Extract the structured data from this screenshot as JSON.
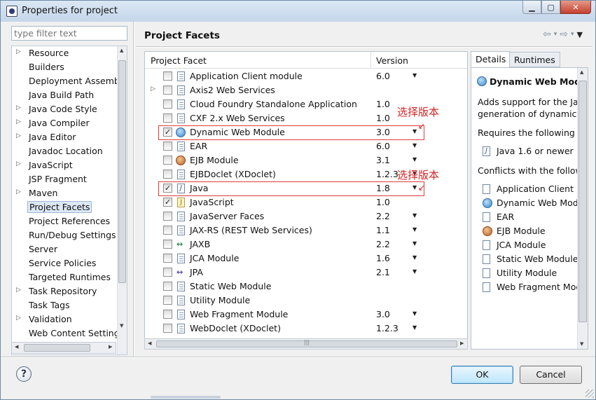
{
  "window": {
    "title": "Properties for project"
  },
  "filter": {
    "placeholder": "type filter text"
  },
  "tree": {
    "items": [
      {
        "label": "Resource",
        "expandable": true,
        "selected": false
      },
      {
        "label": "Builders",
        "expandable": false,
        "selected": false
      },
      {
        "label": "Deployment Assembly",
        "expandable": false,
        "selected": false
      },
      {
        "label": "Java Build Path",
        "expandable": false,
        "selected": false
      },
      {
        "label": "Java Code Style",
        "expandable": true,
        "selected": false
      },
      {
        "label": "Java Compiler",
        "expandable": true,
        "selected": false
      },
      {
        "label": "Java Editor",
        "expandable": true,
        "selected": false
      },
      {
        "label": "Javadoc Location",
        "expandable": false,
        "selected": false
      },
      {
        "label": "JavaScript",
        "expandable": true,
        "selected": false
      },
      {
        "label": "JSP Fragment",
        "expandable": false,
        "selected": false
      },
      {
        "label": "Maven",
        "expandable": true,
        "selected": false
      },
      {
        "label": "Project Facets",
        "expandable": false,
        "selected": true
      },
      {
        "label": "Project References",
        "expandable": false,
        "selected": false
      },
      {
        "label": "Run/Debug Settings",
        "expandable": false,
        "selected": false
      },
      {
        "label": "Server",
        "expandable": false,
        "selected": false
      },
      {
        "label": "Service Policies",
        "expandable": false,
        "selected": false
      },
      {
        "label": "Targeted Runtimes",
        "expandable": false,
        "selected": false
      },
      {
        "label": "Task Repository",
        "expandable": true,
        "selected": false
      },
      {
        "label": "Task Tags",
        "expandable": false,
        "selected": false
      },
      {
        "label": "Validation",
        "expandable": true,
        "selected": false
      },
      {
        "label": "Web Content Settings",
        "expandable": false,
        "selected": false
      }
    ]
  },
  "page": {
    "title": "Project Facets"
  },
  "facets": {
    "col_facet": "Project Facet",
    "col_version": "Version",
    "rows": [
      {
        "label": "Application Client module",
        "version": "6.0",
        "dropdown": true,
        "checked": false,
        "icon": "page",
        "expandable": false
      },
      {
        "label": "Axis2 Web Services",
        "version": "",
        "dropdown": false,
        "checked": false,
        "icon": "page",
        "expandable": true
      },
      {
        "label": "Cloud Foundry Standalone Application",
        "version": "1.0",
        "dropdown": false,
        "checked": false,
        "icon": "page",
        "expandable": false
      },
      {
        "label": "CXF 2.x Web Services",
        "version": "1.0",
        "dropdown": false,
        "checked": false,
        "icon": "page",
        "expandable": false
      },
      {
        "label": "Dynamic Web Module",
        "version": "3.0",
        "dropdown": true,
        "checked": true,
        "icon": "globe",
        "expandable": false
      },
      {
        "label": "EAR",
        "version": "6.0",
        "dropdown": true,
        "checked": false,
        "icon": "page",
        "expandable": false
      },
      {
        "label": "EJB Module",
        "version": "3.1",
        "dropdown": true,
        "checked": false,
        "icon": "bean",
        "expandable": false
      },
      {
        "label": "EJBDoclet (XDoclet)",
        "version": "1.2.3",
        "dropdown": true,
        "checked": false,
        "icon": "page",
        "expandable": false
      },
      {
        "label": "Java",
        "version": "1.8",
        "dropdown": true,
        "checked": true,
        "icon": "java",
        "expandable": false
      },
      {
        "label": "JavaScript",
        "version": "1.0",
        "dropdown": false,
        "checked": true,
        "icon": "js",
        "expandable": false
      },
      {
        "label": "JavaServer Faces",
        "version": "2.2",
        "dropdown": true,
        "checked": false,
        "icon": "page",
        "expandable": false
      },
      {
        "label": "JAX-RS (REST Web Services)",
        "version": "1.1",
        "dropdown": true,
        "checked": false,
        "icon": "page",
        "expandable": false
      },
      {
        "label": "JAXB",
        "version": "2.2",
        "dropdown": true,
        "checked": false,
        "icon": "xml",
        "expandable": false
      },
      {
        "label": "JCA Module",
        "version": "1.6",
        "dropdown": true,
        "checked": false,
        "icon": "page",
        "expandable": false
      },
      {
        "label": "JPA",
        "version": "2.1",
        "dropdown": true,
        "checked": false,
        "icon": "jpa",
        "expandable": false
      },
      {
        "label": "Static Web Module",
        "version": "",
        "dropdown": false,
        "checked": false,
        "icon": "page",
        "expandable": false
      },
      {
        "label": "Utility Module",
        "version": "",
        "dropdown": false,
        "checked": false,
        "icon": "page",
        "expandable": false
      },
      {
        "label": "Web Fragment Module",
        "version": "3.0",
        "dropdown": true,
        "checked": false,
        "icon": "page",
        "expandable": false
      },
      {
        "label": "WebDoclet (XDoclet)",
        "version": "1.2.3",
        "dropdown": true,
        "checked": false,
        "icon": "page",
        "expandable": false
      }
    ]
  },
  "annotations": {
    "label1": "选择版本",
    "label2": "选择版本",
    "color": "#d42424"
  },
  "details": {
    "tab_details": "Details",
    "tab_runtimes": "Runtimes",
    "title": "Dynamic Web Modu",
    "desc_line1": "Adds support for the Jav",
    "desc_line2": "generation of dynamic W",
    "requires": "Requires the following fa",
    "requires_items": [
      {
        "label": "Java 1.6 or newer",
        "icon": "java"
      }
    ],
    "conflicts": "Conflicts with the followi",
    "conflicts_items": [
      {
        "label": "Application Client m",
        "icon": "page"
      },
      {
        "label": "Dynamic Web Modu",
        "icon": "globe"
      },
      {
        "label": "EAR",
        "icon": "page"
      },
      {
        "label": "EJB Module",
        "icon": "bean"
      },
      {
        "label": "JCA Module",
        "icon": "page"
      },
      {
        "label": "Static Web Module",
        "icon": "page"
      },
      {
        "label": "Utility Module",
        "icon": "page"
      },
      {
        "label": "Web Fragment Mod",
        "icon": "page"
      }
    ]
  },
  "buttons": {
    "help": "?",
    "ok": "OK",
    "cancel": "Cancel"
  }
}
